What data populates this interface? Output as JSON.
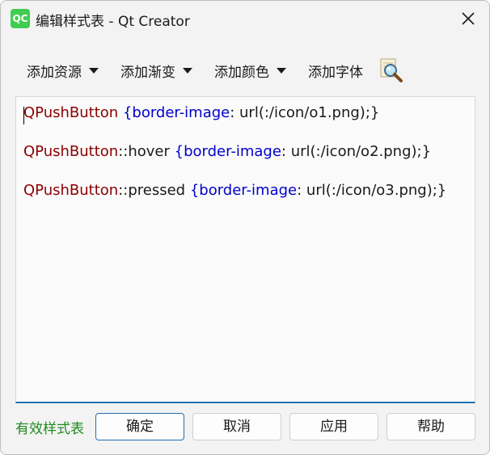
{
  "window": {
    "app_logo_text": "QC",
    "title": "编辑样式表 - Qt Creator"
  },
  "toolbar": {
    "items": [
      {
        "label": "添加资源",
        "has_dropdown": true
      },
      {
        "label": "添加渐变",
        "has_dropdown": true
      },
      {
        "label": "添加颜色",
        "has_dropdown": true
      },
      {
        "label": "添加字体",
        "has_dropdown": false
      }
    ],
    "find_icon": "magnifier-icon"
  },
  "editor": {
    "lines": [
      {
        "selector": "QPushButton",
        "pseudo": "",
        "space": " ",
        "open_brace": "{",
        "property": "border-image",
        "value": ": url(:/icon/o1.png);}"
      },
      {
        "selector": "QPushButton",
        "pseudo": "::hover",
        "space": " ",
        "open_brace": "{",
        "property": "border-image",
        "value": ": url(:/icon/o2.png);}"
      },
      {
        "selector": "QPushButton",
        "pseudo": "::pressed",
        "space": " ",
        "open_brace": "{",
        "property": "border-image",
        "value": ": url(:/icon/o3.png);}"
      }
    ]
  },
  "footer": {
    "status": "有效样式表",
    "buttons": {
      "ok": "确定",
      "cancel": "取消",
      "apply": "应用",
      "help": "帮助"
    }
  },
  "colors": {
    "selector": "#8b0000",
    "property": "#0000cc",
    "valid_status": "#1e8a1e",
    "accent": "#1f6fb2",
    "qt_green": "#41cd52"
  }
}
